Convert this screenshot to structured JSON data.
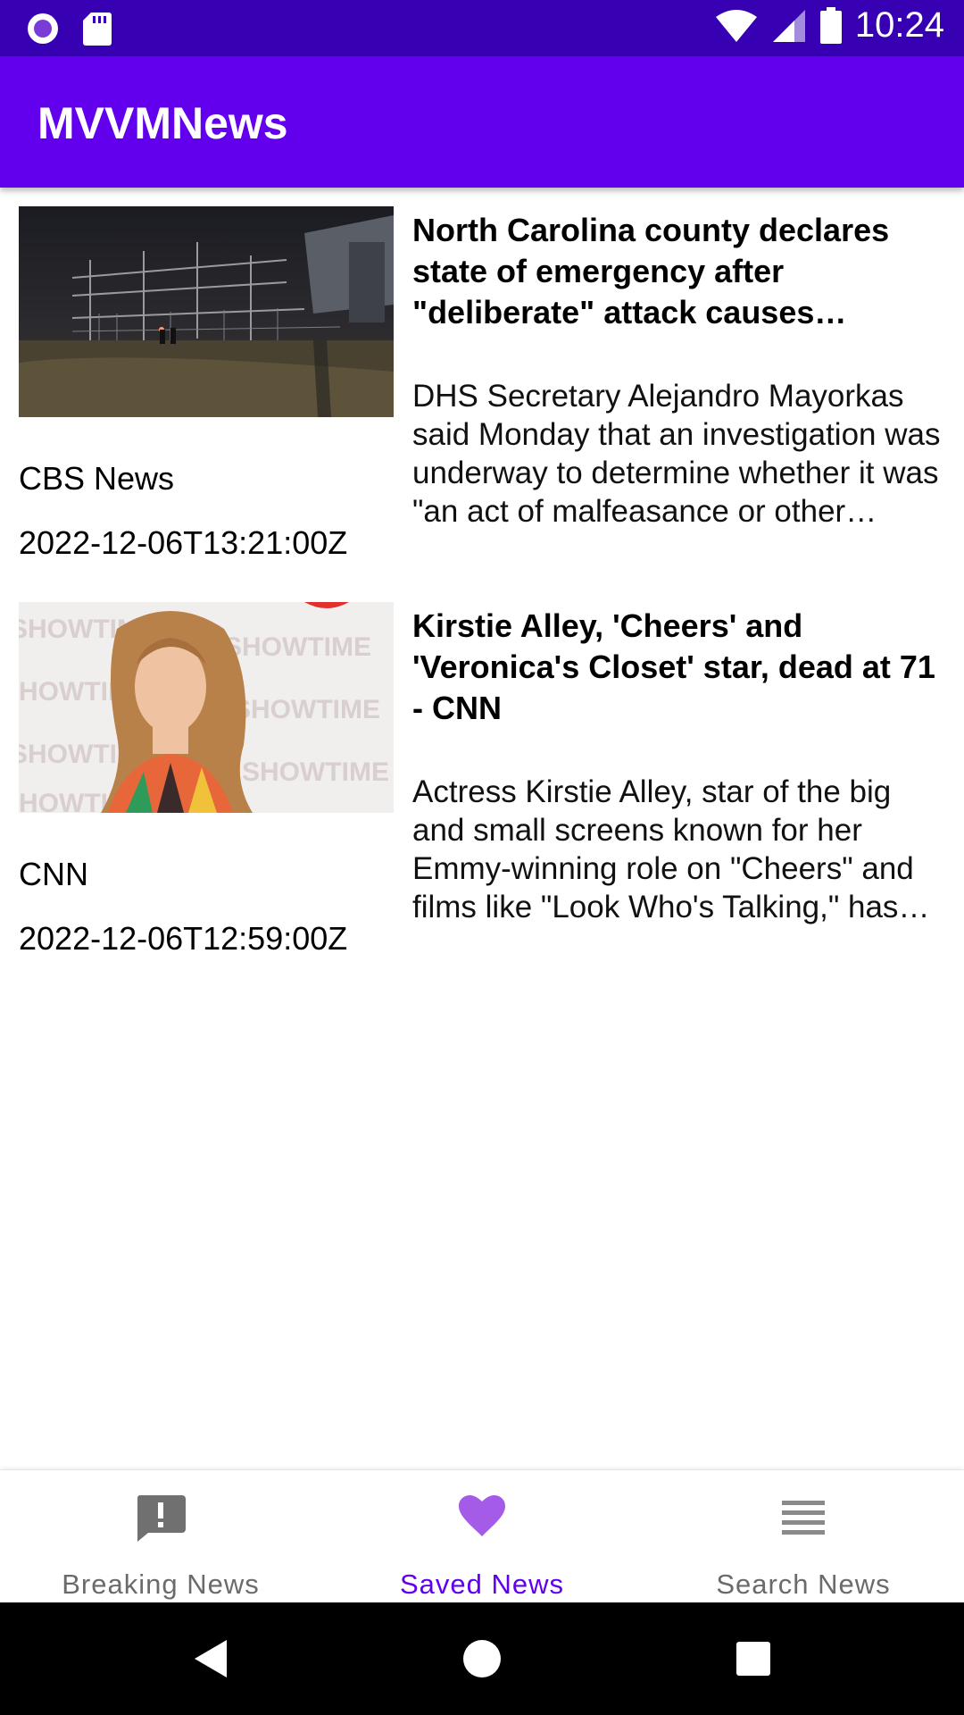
{
  "status_bar": {
    "time": "10:24",
    "icons": [
      "circle-notification-icon",
      "sd-card-icon",
      "wifi-icon",
      "cell-signal-icon",
      "battery-icon"
    ]
  },
  "app_bar": {
    "title": "MVVMNews",
    "color": "#6200ee",
    "status_color": "#3700b3"
  },
  "articles": [
    {
      "title": "North Carolina county declares state of emergency after \"deliberate\" attack causes widespread power outages",
      "description": "DHS Secretary Alejandro Mayorkas said Monday that an investigation was underway to determine whether it was \"an act of malfeasance or other criminal intent\"",
      "source": "CBS News",
      "published_at": "2022-12-06T13:21:00Z",
      "image": "power-substation-night-photo"
    },
    {
      "title": "Kirstie Alley, 'Cheers' and 'Veronica's Closet' star, dead at 71 - CNN",
      "description": "Actress Kirstie Alley, star of the big and small screens known for her Emmy-winning role on \"Cheers\" and films like \"Look Who's Talking,\" has died",
      "source": "CNN",
      "published_at": "2022-12-06T12:59:00Z",
      "image": "kirstie-alley-red-carpet-photo"
    }
  ],
  "bottom_nav": {
    "items": [
      {
        "label": "Breaking News",
        "icon": "feedback-exclamation-icon",
        "active": false
      },
      {
        "label": "Saved News",
        "icon": "heart-icon",
        "active": true
      },
      {
        "label": "Search News",
        "icon": "list-lines-icon",
        "active": false
      }
    ],
    "active_color": "#6200ee",
    "inactive_color": "#6b6b6b"
  },
  "system_nav": [
    "back-icon",
    "home-icon",
    "recents-icon"
  ]
}
